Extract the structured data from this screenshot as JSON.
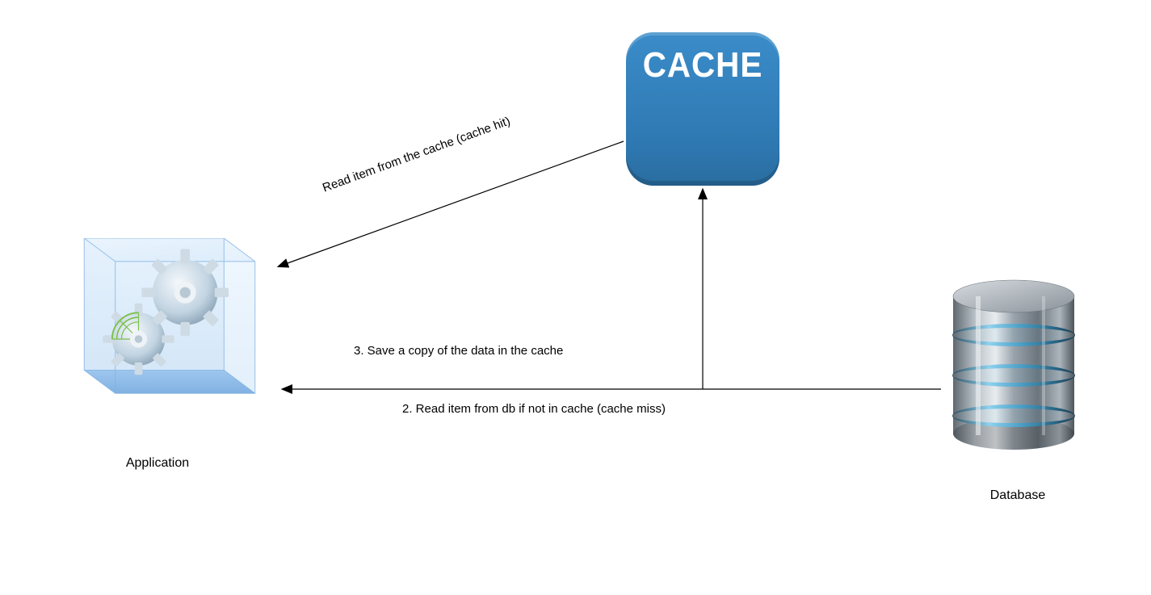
{
  "nodes": {
    "application": {
      "label": "Application"
    },
    "cache": {
      "title": "CACHE"
    },
    "database": {
      "label": "Database"
    }
  },
  "edges": {
    "cache_to_app": {
      "label": "Read item from the cache (cache hit)"
    },
    "db_to_app": {
      "label": "2. Read item from db if not in cache (cache miss)"
    },
    "app_to_cache": {
      "label": "3. Save a copy of the data in the cache"
    }
  },
  "colors": {
    "cache_blue": "#2f79b3",
    "app_blue": "#9fc9ef",
    "db_gray": "#8f959c",
    "db_accent": "#6fb7d6"
  }
}
